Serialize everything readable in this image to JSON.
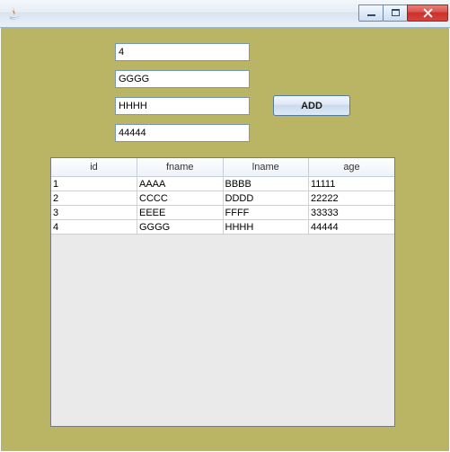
{
  "window": {
    "title": ""
  },
  "form": {
    "id_value": "4",
    "fname_value": "GGGG",
    "lname_value": "HHHH",
    "age_value": "44444",
    "add_label": "ADD"
  },
  "table": {
    "headers": [
      "id",
      "fname",
      "lname",
      "age"
    ],
    "rows": [
      [
        "1",
        "AAAA",
        "BBBB",
        "11111"
      ],
      [
        "2",
        "CCCC",
        "DDDD",
        "22222"
      ],
      [
        "3",
        "EEEE",
        "FFFF",
        "33333"
      ],
      [
        "4",
        "GGGG",
        "HHHH",
        "44444"
      ]
    ]
  }
}
